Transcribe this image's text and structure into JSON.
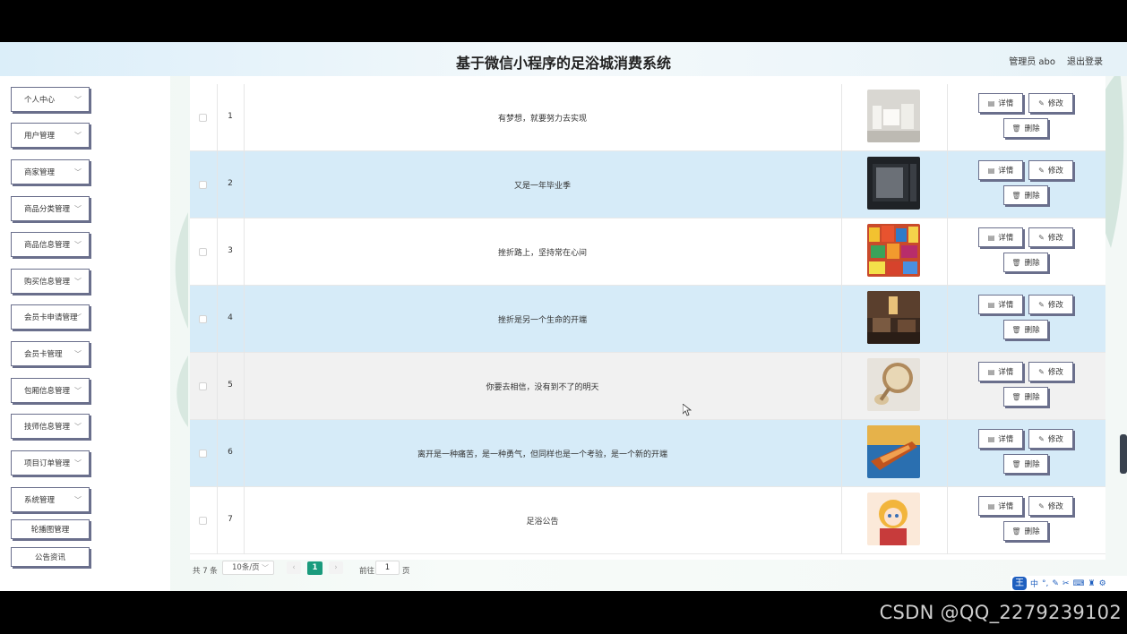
{
  "header": {
    "title": "基于微信小程序的足浴城消费系统",
    "user": "管理员 abo",
    "logout": "退出登录"
  },
  "sidebar": {
    "items": [
      {
        "label": "个人中心"
      },
      {
        "label": "用户管理"
      },
      {
        "label": "商家管理"
      },
      {
        "label": "商品分类管理"
      },
      {
        "label": "商品信息管理"
      },
      {
        "label": "购买信息管理"
      },
      {
        "label": "会员卡申请管理"
      },
      {
        "label": "会员卡管理"
      },
      {
        "label": "包厢信息管理"
      },
      {
        "label": "技师信息管理"
      },
      {
        "label": "项目订单管理"
      },
      {
        "label": "系统管理"
      }
    ],
    "sub_items": [
      {
        "label": "轮播图管理"
      },
      {
        "label": "公告资讯"
      }
    ]
  },
  "table": {
    "rows": [
      {
        "index": "1",
        "title": "有梦想，就要努力去实现"
      },
      {
        "index": "2",
        "title": "又是一年毕业季"
      },
      {
        "index": "3",
        "title": "挫折路上，坚持常在心间"
      },
      {
        "index": "4",
        "title": "挫折是另一个生命的开端"
      },
      {
        "index": "5",
        "title": "你要去相信，没有到不了的明天"
      },
      {
        "index": "6",
        "title": "离开是一种痛苦，是一种勇气，但同样也是一个考验，是一个新的开端"
      },
      {
        "index": "7",
        "title": "足浴公告"
      }
    ],
    "actions": {
      "detail": "详情",
      "edit": "修改",
      "delete": "删除"
    }
  },
  "pagination": {
    "total": "共 7 条",
    "page_size": "10条/页",
    "current_page": "1",
    "goto_label": "前往",
    "goto_value": "1",
    "page_unit": "页"
  },
  "ime": {
    "logo": "王",
    "mode": "中"
  },
  "watermark": "CSDN @QQ_2279239102",
  "colors": {
    "accent": "#1a9b7d",
    "row_highlight": "#d6ebf8",
    "button_border": "#6a6f8c"
  }
}
